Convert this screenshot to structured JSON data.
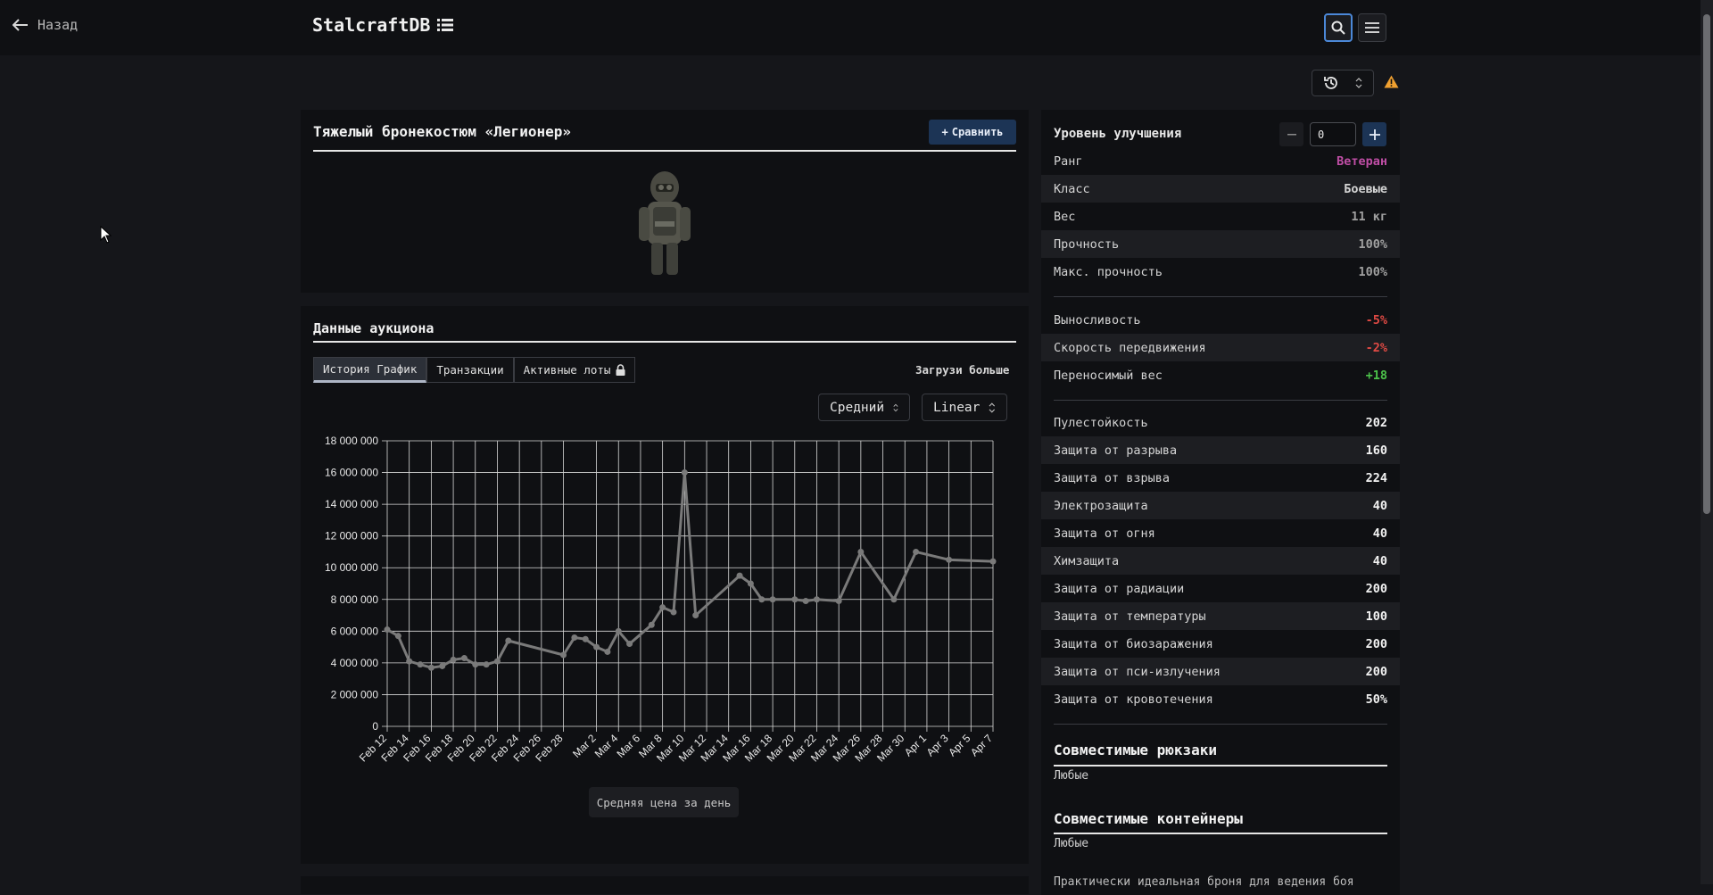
{
  "header": {
    "back_label": "Назад",
    "brand": "StalcraftDB"
  },
  "item": {
    "title": "Тяжелый бронекостюм «Легионер»",
    "compare_label": "Сравнить"
  },
  "auction": {
    "title": "Данные аукциона",
    "tabs": [
      {
        "label": "История График",
        "active": true
      },
      {
        "label": "Транзакции",
        "active": false
      },
      {
        "label": "Активные лоты",
        "active": false,
        "locked": true
      }
    ],
    "load_more": "Загрузи больше",
    "mode_select": "Средний",
    "scale_select": "Linear",
    "caption": "Средняя цена за день"
  },
  "chart_data": {
    "type": "line",
    "ylim": [
      0,
      18000000
    ],
    "y_ticks": [
      "0",
      "2 000 000",
      "4 000 000",
      "6 000 000",
      "8 000 000",
      "10 000 000",
      "12 000 000",
      "14 000 000",
      "16 000 000",
      "18 000 000"
    ],
    "x_ticks": [
      "Feb 12",
      "Feb 14",
      "Feb 16",
      "Feb 18",
      "Feb 20",
      "Feb 22",
      "Feb 24",
      "Feb 26",
      "Feb 28",
      "Mar 2",
      "Mar 4",
      "Mar 6",
      "Mar 8",
      "Mar 10",
      "Mar 12",
      "Mar 14",
      "Mar 16",
      "Mar 18",
      "Mar 20",
      "Mar 22",
      "Mar 24",
      "Mar 26",
      "Mar 28",
      "Mar 30",
      "Apr 1",
      "Apr 3",
      "Apr 5",
      "Apr 7"
    ],
    "series": [
      {
        "color": "#7a7a7a",
        "points": [
          [
            "Feb 12",
            6100000
          ],
          [
            "Feb 13",
            5700000
          ],
          [
            "Feb 14",
            4100000
          ],
          [
            "Feb 15",
            3900000
          ],
          [
            "Feb 16",
            3700000
          ],
          [
            "Feb 17",
            3800000
          ],
          [
            "Feb 18",
            4200000
          ],
          [
            "Feb 19",
            4300000
          ],
          [
            "Feb 20",
            3900000
          ],
          [
            "Feb 21",
            3900000
          ],
          [
            "Feb 22",
            4100000
          ],
          [
            "Feb 23",
            5400000
          ],
          [
            "Feb 28",
            4500000
          ],
          [
            "Feb 29",
            5600000
          ],
          [
            "Mar 1",
            5500000
          ],
          [
            "Mar 2",
            5000000
          ],
          [
            "Mar 3",
            4700000
          ],
          [
            "Mar 4",
            6000000
          ],
          [
            "Mar 5",
            5200000
          ],
          [
            "Mar 7",
            6400000
          ],
          [
            "Mar 8",
            7500000
          ],
          [
            "Mar 9",
            7200000
          ],
          [
            "Mar 10",
            16000000
          ],
          [
            "Mar 11",
            7000000
          ],
          [
            "Mar 15",
            9500000
          ],
          [
            "Mar 16",
            9000000
          ],
          [
            "Mar 17",
            8000000
          ],
          [
            "Mar 18",
            8000000
          ],
          [
            "Mar 20",
            8000000
          ],
          [
            "Mar 21",
            7900000
          ],
          [
            "Mar 22",
            8000000
          ],
          [
            "Mar 24",
            7900000
          ],
          [
            "Mar 26",
            11000000
          ],
          [
            "Mar 29",
            8000000
          ],
          [
            "Mar 31",
            11000000
          ],
          [
            "Apr 3",
            10500000
          ],
          [
            "Apr 7",
            10400000
          ]
        ]
      }
    ]
  },
  "stats": {
    "upgrade_label": "Уровень улучшения",
    "upgrade_value": "0",
    "group1": [
      {
        "label": "Ранг",
        "value": "Ветеран",
        "color": "#c04ea6"
      },
      {
        "label": "Класс",
        "value": "Боевые",
        "color": "#d4d4d4"
      },
      {
        "label": "Вес",
        "value": "11 кг",
        "color": "#a0a0a0"
      },
      {
        "label": "Прочность",
        "value": "100%",
        "color": "#a0a0a0"
      },
      {
        "label": "Макс. прочность",
        "value": "100%",
        "color": "#a0a0a0"
      }
    ],
    "group2": [
      {
        "label": "Выносливость",
        "value": "-5%",
        "color": "#e04a44"
      },
      {
        "label": "Скорость передвижения",
        "value": "-2%",
        "color": "#e04a44"
      },
      {
        "label": "Переносимый вес",
        "value": "+18",
        "color": "#4cc24a"
      }
    ],
    "group3": [
      {
        "label": "Пулестойкость",
        "value": "202"
      },
      {
        "label": "Защита от разрыва",
        "value": "160"
      },
      {
        "label": "Защита от взрыва",
        "value": "224"
      },
      {
        "label": "Электрозащита",
        "value": "40"
      },
      {
        "label": "Защита от огня",
        "value": "40"
      },
      {
        "label": "Химзащита",
        "value": "40"
      },
      {
        "label": "Защита от радиации",
        "value": "200"
      },
      {
        "label": "Защита от температуры",
        "value": "100"
      },
      {
        "label": "Защита от биозаражения",
        "value": "200"
      },
      {
        "label": "Защита от пси-излучения",
        "value": "200"
      },
      {
        "label": "Защита от кровотечения",
        "value": "50%"
      }
    ],
    "backpacks_title": "Совместимые рюкзаки",
    "backpacks_value": "Любые",
    "containers_title": "Совместимые контейнеры",
    "containers_value": "Любые",
    "description_snippet": "Практически идеальная броня для ведения боя"
  }
}
